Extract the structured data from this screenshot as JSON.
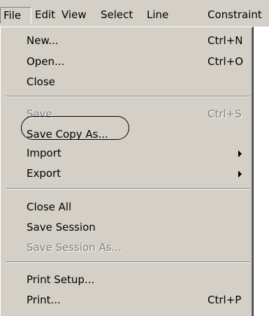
{
  "menubar": {
    "items": [
      {
        "label": "File"
      },
      {
        "label": "Edit"
      },
      {
        "label": "View"
      },
      {
        "label": "Select"
      },
      {
        "label": "Line"
      },
      {
        "label": "Constraint"
      }
    ]
  },
  "file_menu": {
    "items": [
      {
        "label": "New...",
        "shortcut": "Ctrl+N",
        "enabled": true
      },
      {
        "label": "Open...",
        "shortcut": "Ctrl+O",
        "enabled": true
      },
      {
        "label": "Close",
        "shortcut": "",
        "enabled": true
      },
      {
        "label": "Save",
        "shortcut": "Ctrl+S",
        "enabled": false
      },
      {
        "label": "Save Copy As...",
        "shortcut": "",
        "enabled": true,
        "annotated": true
      },
      {
        "label": "Import",
        "shortcut": "",
        "enabled": true,
        "submenu": true
      },
      {
        "label": "Export",
        "shortcut": "",
        "enabled": true,
        "submenu": true
      },
      {
        "label": "Close All",
        "shortcut": "",
        "enabled": true
      },
      {
        "label": "Save Session",
        "shortcut": "",
        "enabled": true
      },
      {
        "label": "Save Session As...",
        "shortcut": "",
        "enabled": false
      },
      {
        "label": "Print Setup...",
        "shortcut": "",
        "enabled": true
      },
      {
        "label": "Print...",
        "shortcut": "Ctrl+P",
        "enabled": true
      }
    ]
  },
  "colors": {
    "menu_background": "#d4d0c8",
    "disabled_text": "#808080",
    "text": "#000000"
  }
}
